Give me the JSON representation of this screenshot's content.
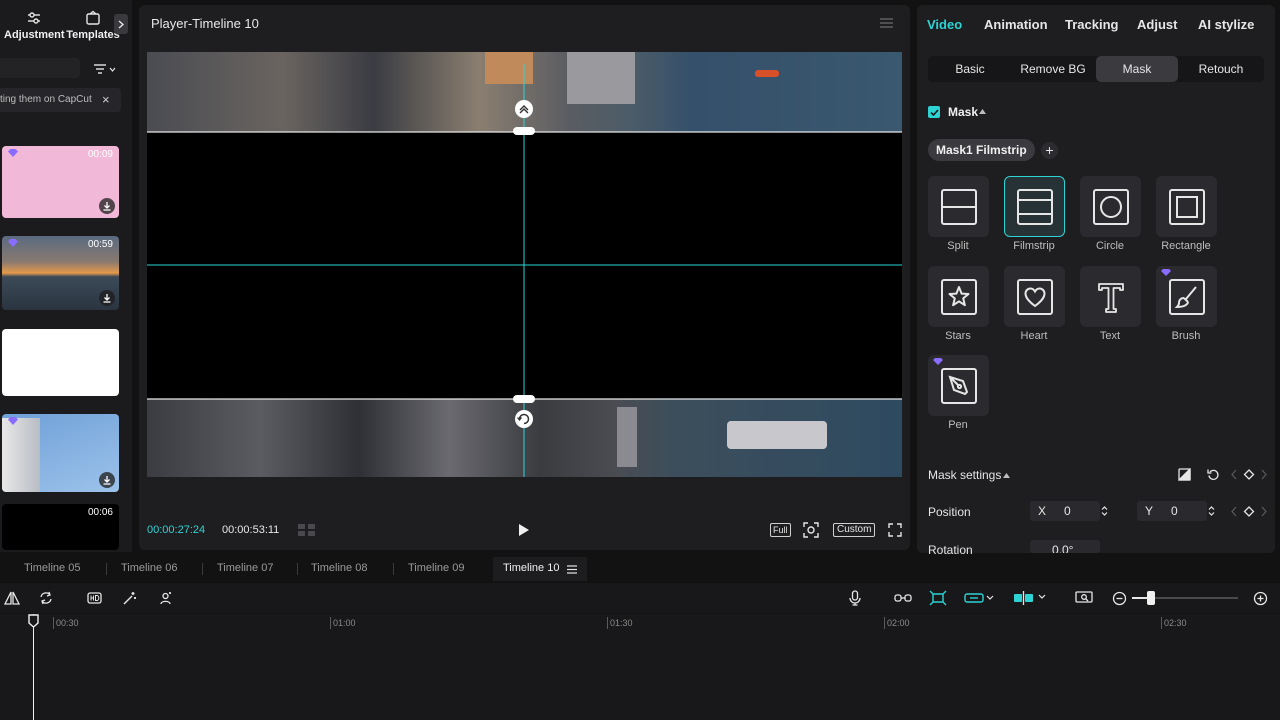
{
  "left_panel": {
    "tabs": [
      {
        "label": "Adjustment",
        "icon": "sliders-icon"
      },
      {
        "label": "Templates",
        "icon": "templates-icon"
      }
    ],
    "banner_text": "ting them on CapCut",
    "media": [
      {
        "duration": "00:09",
        "color": "#f2b8d8",
        "premium": true,
        "downloadable": true
      },
      {
        "duration": "00:59",
        "premium": true,
        "downloadable": true
      },
      {
        "duration": "",
        "color": "#ffffff",
        "premium": false,
        "downloadable": false
      },
      {
        "duration": "",
        "premium": true,
        "downloadable": true
      },
      {
        "duration": "00:06",
        "color": "#000000",
        "premium": false,
        "downloadable": false
      }
    ]
  },
  "player": {
    "title": "Player-Timeline 10",
    "current_time": "00:00:27:24",
    "total_time": "00:00:53:11",
    "full_label": "Full",
    "ratio_label": "Custom"
  },
  "right_panel": {
    "tabs": [
      "Video",
      "Animation",
      "Tracking",
      "Adjust",
      "AI stylize"
    ],
    "active_tab": "Video",
    "subtabs": [
      "Basic",
      "Remove BG",
      "Mask",
      "Retouch"
    ],
    "active_subtab": "Mask",
    "mask": {
      "label": "Mask",
      "enabled": true,
      "chip_label": "Mask1 Filmstrip",
      "selected": "Filmstrip",
      "shapes": [
        {
          "label": "Split",
          "icon": "split-mask-icon"
        },
        {
          "label": "Filmstrip",
          "icon": "filmstrip-mask-icon"
        },
        {
          "label": "Circle",
          "icon": "circle-mask-icon"
        },
        {
          "label": "Rectangle",
          "icon": "rectangle-mask-icon"
        },
        {
          "label": "Stars",
          "icon": "star-mask-icon"
        },
        {
          "label": "Heart",
          "icon": "heart-mask-icon"
        },
        {
          "label": "Text",
          "icon": "text-mask-icon"
        },
        {
          "label": "Brush",
          "icon": "brush-mask-icon",
          "premium": true
        },
        {
          "label": "Pen",
          "icon": "pen-mask-icon",
          "premium": true
        }
      ]
    },
    "settings": {
      "title": "Mask settings",
      "position_label": "Position",
      "x_label": "X",
      "x_value": "0",
      "y_label": "Y",
      "y_value": "0",
      "rotation_label": "Rotation",
      "rotation_value": "0.0°"
    }
  },
  "timeline": {
    "tabs": [
      "Timeline 05",
      "Timeline 06",
      "Timeline 07",
      "Timeline 08",
      "Timeline 09",
      "Timeline 10"
    ],
    "active_tab": "Timeline 10",
    "ruler": [
      "00:30",
      "01:00",
      "01:30",
      "02:00",
      "02:30"
    ]
  },
  "colors": {
    "accent": "#2ed3d3",
    "premium": "#8a6cff"
  }
}
